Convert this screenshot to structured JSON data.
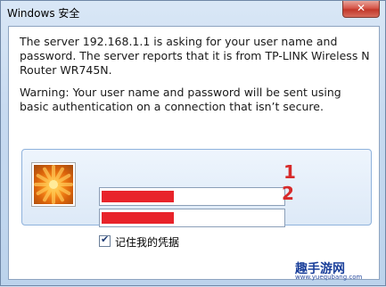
{
  "window": {
    "title": "Windows 安全",
    "close_label": "✕"
  },
  "message": {
    "line1": "The server 192.168.1.1 is asking for your user name and password. The server reports that it is from TP-LINK Wireless N Router WR745N.",
    "warning": "Warning: Your user name and password will be sent using basic authentication on a connection that isn’t secure."
  },
  "credentials": {
    "username_value": "",
    "password_value": "",
    "remember_label": "记住我的凭据",
    "remember_checked": true,
    "redaction_color": "#e8232a"
  },
  "annotations": [
    "1",
    "2"
  ],
  "watermark": {
    "title": "趣手游网",
    "url": "www.yuequbang.com"
  },
  "colors": {
    "annotation": "#d72a2a",
    "close_button": "#c2382a"
  }
}
